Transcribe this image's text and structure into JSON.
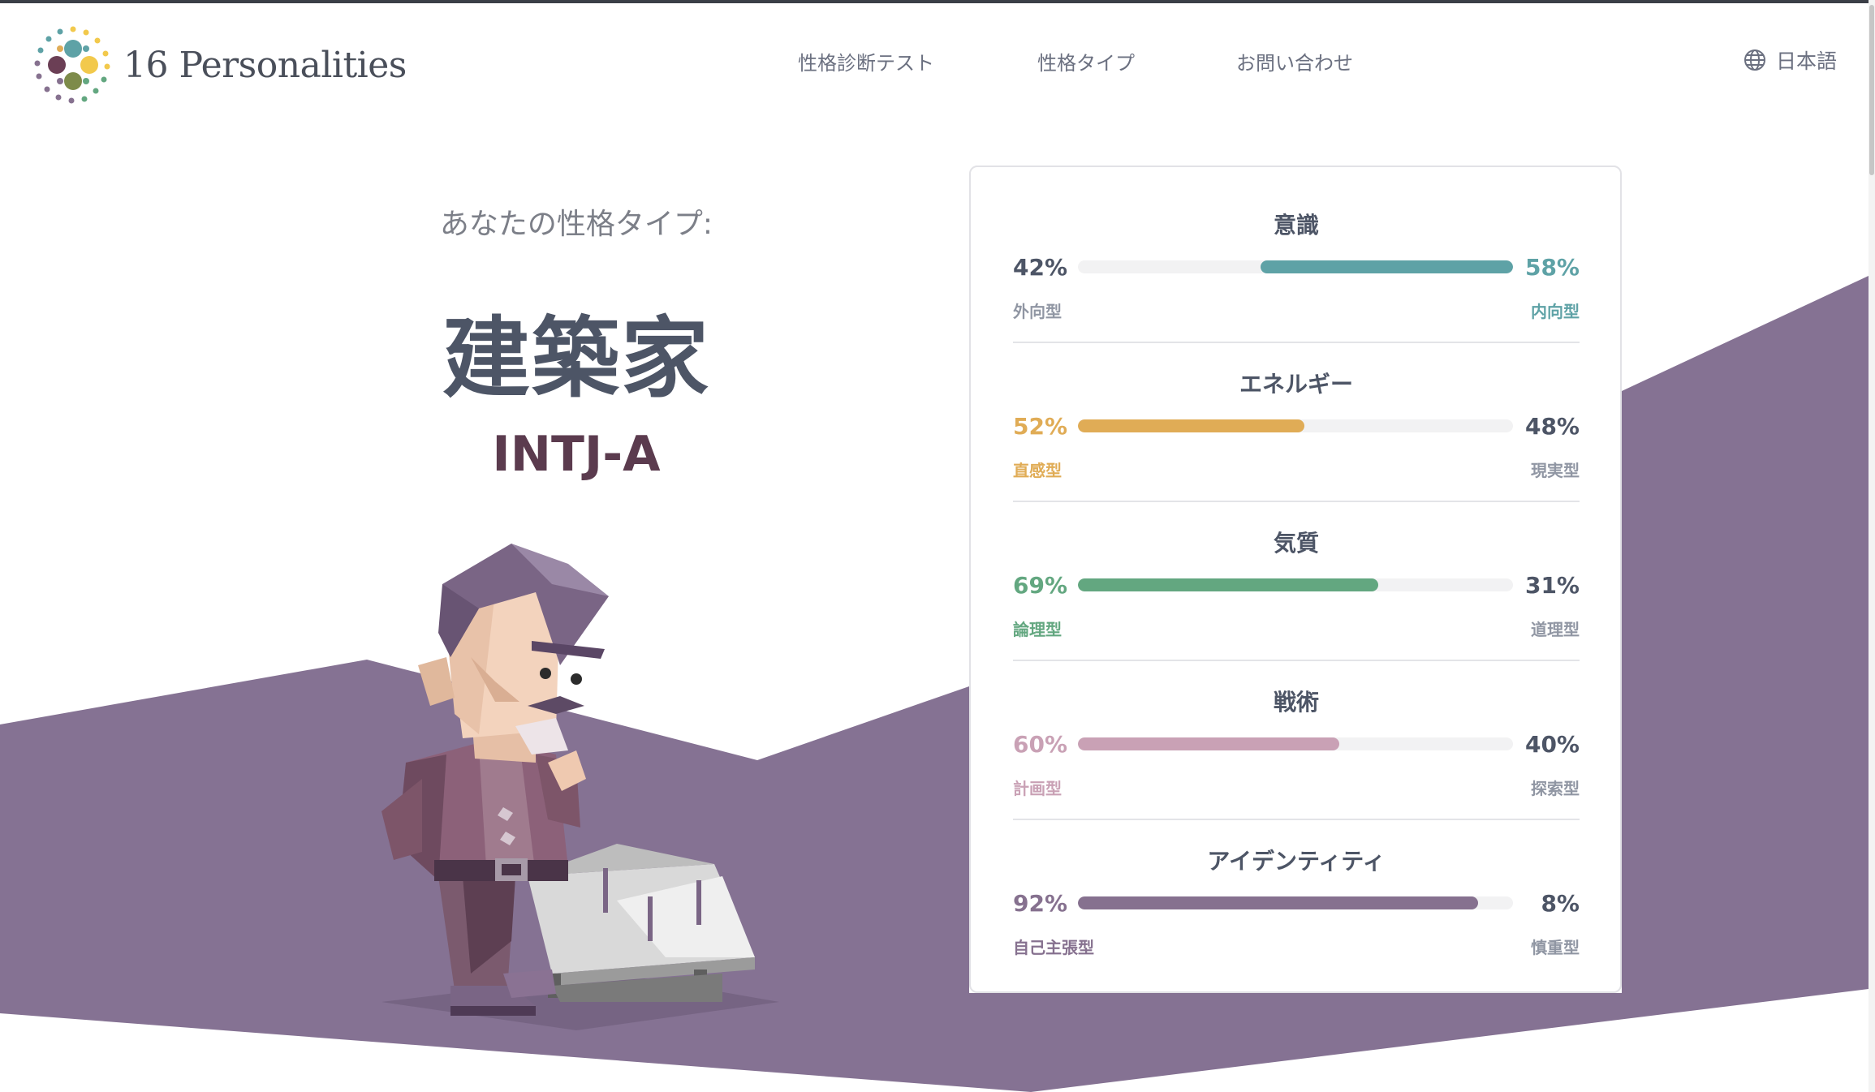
{
  "brand": {
    "name": "16 Personalities"
  },
  "nav": {
    "items": [
      {
        "label": "性格診断テスト"
      },
      {
        "label": "性格タイプ"
      },
      {
        "label": "お問い合わせ"
      }
    ],
    "language": "日本語",
    "language_icon": "globe-icon"
  },
  "result": {
    "subtitle": "あなたの性格タイプ:",
    "type_name": "建築家",
    "type_code": "INTJ-A"
  },
  "colors": {
    "purple_bg": "#857293",
    "teal": "#5ea2a6",
    "yellow": "#e0ac56",
    "green": "#63a780",
    "pink": "#c9a1b5",
    "purple": "#86718f"
  },
  "traits": [
    {
      "title": "意識",
      "left_pct": "42%",
      "right_pct": "58%",
      "left_label": "外向型",
      "right_label": "内向型",
      "dominant": "right",
      "value": 58,
      "color": "#5ea2a6"
    },
    {
      "title": "エネルギー",
      "left_pct": "52%",
      "right_pct": "48%",
      "left_label": "直感型",
      "right_label": "現実型",
      "dominant": "left",
      "value": 52,
      "color": "#e0ac56"
    },
    {
      "title": "気質",
      "left_pct": "69%",
      "right_pct": "31%",
      "left_label": "論理型",
      "right_label": "道理型",
      "dominant": "left",
      "value": 69,
      "color": "#63a780"
    },
    {
      "title": "戦術",
      "left_pct": "60%",
      "right_pct": "40%",
      "left_label": "計画型",
      "right_label": "探索型",
      "dominant": "left",
      "value": 60,
      "color": "#c9a1b5"
    },
    {
      "title": "アイデンティティ",
      "left_pct": "92%",
      "right_pct": "8%",
      "left_label": "自己主張型",
      "right_label": "慎重型",
      "dominant": "left",
      "value": 92,
      "color": "#86718f"
    }
  ]
}
